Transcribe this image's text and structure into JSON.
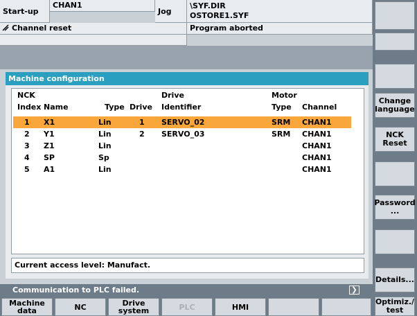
{
  "header": {
    "mode": "Start-up",
    "channel": "CHAN1",
    "op_mode": "Jog",
    "program_path_1": "\\SYF.DIR",
    "program_path_2": "OSTORE1.SYF",
    "channel_state": "Channel reset",
    "program_state": "Program aborted"
  },
  "window": {
    "title": "Machine configuration",
    "col_headers_top": {
      "nck": "NCK",
      "drive": "Drive",
      "motor": "Motor"
    },
    "col_headers": {
      "index": "Index",
      "name": "Name",
      "type": "Type",
      "drive": "Drive",
      "identifier": "Identifier",
      "motor_type": "Type",
      "channel": "Channel"
    },
    "rows": [
      {
        "index": "1",
        "name": "X1",
        "type": "Lin",
        "drive": "1",
        "identifier": "SERVO_02",
        "motor_type": "SRM",
        "channel": "CHAN1"
      },
      {
        "index": "2",
        "name": "Y1",
        "type": "Lin",
        "drive": "2",
        "identifier": "SERVO_03",
        "motor_type": "SRM",
        "channel": "CHAN1"
      },
      {
        "index": "3",
        "name": "Z1",
        "type": "Lin",
        "drive": "",
        "identifier": "",
        "motor_type": "",
        "channel": "CHAN1"
      },
      {
        "index": "4",
        "name": "SP",
        "type": "Sp",
        "drive": "",
        "identifier": "",
        "motor_type": "",
        "channel": "CHAN1"
      },
      {
        "index": "5",
        "name": "A1",
        "type": "Lin",
        "drive": "",
        "identifier": "",
        "motor_type": "",
        "channel": "CHAN1"
      }
    ],
    "access_level": "Current access level: Manufact."
  },
  "status_line": {
    "message": "Communication to PLC failed.",
    "icon": "chevron-right-icon"
  },
  "vertical_softkeys": {
    "change_language_1": "Change",
    "change_language_2": "language",
    "nck_reset_1": "NCK",
    "nck_reset_2": "Reset",
    "password_1": "Password",
    "password_2": "...",
    "details": "Details...",
    "optimize_1": "Optimiz./",
    "optimize_2": "test"
  },
  "horizontal_softkeys": {
    "machine_data_1": "Machine",
    "machine_data_2": "data",
    "nc": "NC",
    "drive_system_1": "Drive",
    "drive_system_2": "system",
    "plc": "PLC",
    "hmi": "HMI"
  },
  "colors": {
    "title_bar": "#2a9fbf",
    "selection": "#f9a63b",
    "status_bar": "#6d7c88",
    "softkey": "#d4dadf"
  }
}
